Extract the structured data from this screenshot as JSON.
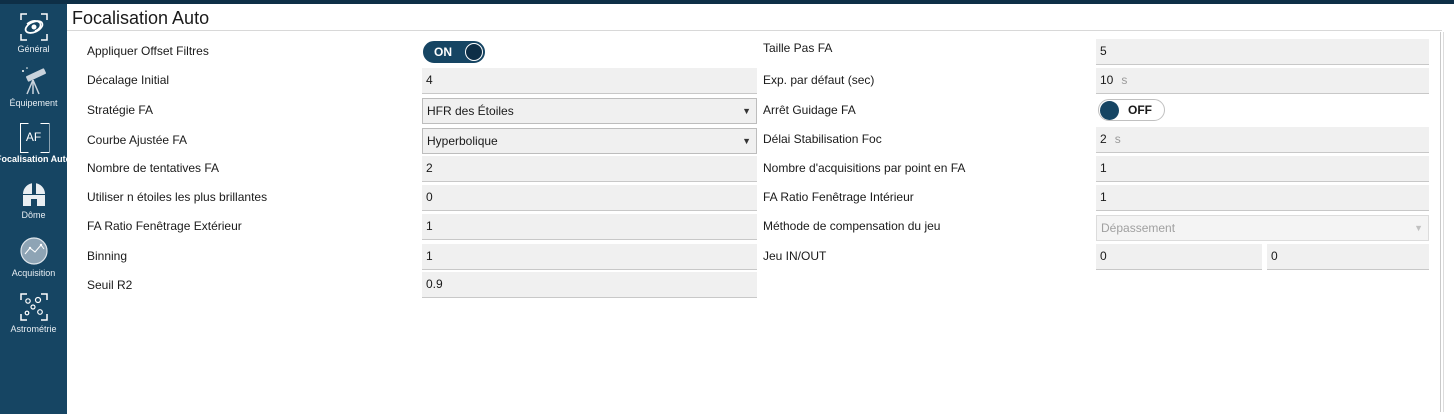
{
  "page_title": "Focalisation Auto",
  "sidebar": {
    "items": [
      {
        "label": "Général",
        "icon": "galaxy-icon"
      },
      {
        "label": "Équipement",
        "icon": "telescope-icon"
      },
      {
        "label": "Focalisation Auto",
        "icon": "af-icon",
        "icon_text": "AF"
      },
      {
        "label": "Dôme",
        "icon": "observatory-dome-icon"
      },
      {
        "label": "Acquisition",
        "icon": "sky-chart-icon"
      },
      {
        "label": "Astrométrie",
        "icon": "star-field-icon"
      }
    ]
  },
  "left": {
    "apply_filter_offsets": {
      "label": "Appliquer Offset Filtres",
      "value": "ON"
    },
    "initial_offset": {
      "label": "Décalage Initial",
      "value": "4"
    },
    "af_strategy": {
      "label": "Stratégie FA",
      "value": "HFR des Étoiles"
    },
    "fitted_curve": {
      "label": "Courbe Ajustée FA",
      "value": "Hyperbolique"
    },
    "attempts": {
      "label": "Nombre de tentatives FA",
      "value": "2"
    },
    "use_brightest": {
      "label": "Utiliser n étoiles les plus brillantes",
      "value": "0"
    },
    "outer_crop": {
      "label": "FA Ratio Fenêtrage Extérieur",
      "value": "1"
    },
    "binning": {
      "label": "Binning",
      "value": "1"
    },
    "r2_threshold": {
      "label": "Seuil R2",
      "value": "0.9"
    }
  },
  "right": {
    "step_size": {
      "label": "Taille Pas FA",
      "value": "5"
    },
    "default_exposure": {
      "label": "Exp. par défaut (sec)",
      "value": "10",
      "unit": "s"
    },
    "disable_guiding": {
      "label": "Arrêt Guidage FA",
      "value": "OFF"
    },
    "focuser_settle": {
      "label": "Délai Stabilisation Foc",
      "value": "2",
      "unit": "s"
    },
    "frames_per_point": {
      "label": "Nombre d'acquisitions par point en FA",
      "value": "1"
    },
    "inner_crop": {
      "label": "FA Ratio Fenêtrage Intérieur",
      "value": "1"
    },
    "backlash_method": {
      "label": "Méthode de compensation du jeu",
      "value": "Dépassement"
    },
    "backlash_in_out": {
      "label": "Jeu IN/OUT",
      "in_value": "0",
      "out_value": "0"
    }
  },
  "colors": {
    "sidebar": "#164563",
    "toggle": "#164563"
  }
}
